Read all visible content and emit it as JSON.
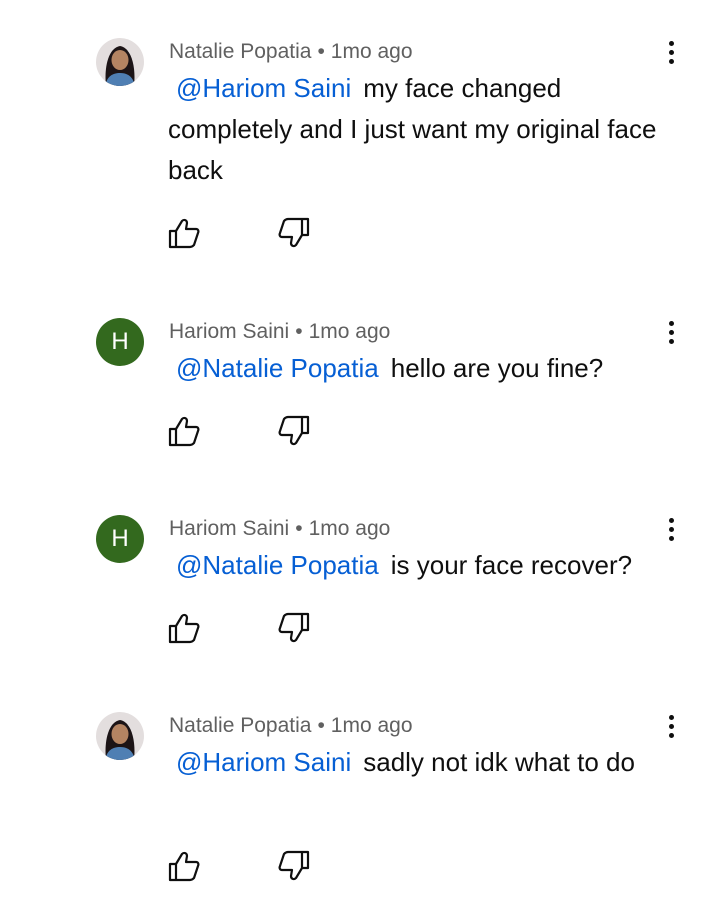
{
  "comments": [
    {
      "author": "Natalie Popatia",
      "separator": "•",
      "time": "1mo ago",
      "avatar_type": "photo",
      "mention": "@Hariom Saini",
      "text": "my face changed completely and I just want my original face back"
    },
    {
      "author": "Hariom Saini",
      "separator": "•",
      "time": "1mo ago",
      "avatar_type": "letter",
      "avatar_letter": "H",
      "avatar_color": "#33691e",
      "mention": "@Natalie Popatia",
      "text": "hello are you fine?"
    },
    {
      "author": "Hariom Saini",
      "separator": "•",
      "time": "1mo ago",
      "avatar_type": "letter",
      "avatar_letter": "H",
      "avatar_color": "#33691e",
      "mention": "@Natalie Popatia",
      "text": "is your face recover?"
    },
    {
      "author": "Natalie Popatia",
      "separator": "•",
      "time": "1mo ago",
      "avatar_type": "photo",
      "mention": "@Hariom Saini",
      "text": "sadly not idk what to do"
    }
  ],
  "icons": {
    "like": "thumbs-up-icon",
    "dislike": "thumbs-down-icon",
    "menu": "more-vertical-icon"
  },
  "colors": {
    "mention": "#065fd4",
    "meta": "#606060",
    "text": "#0f0f0f"
  }
}
